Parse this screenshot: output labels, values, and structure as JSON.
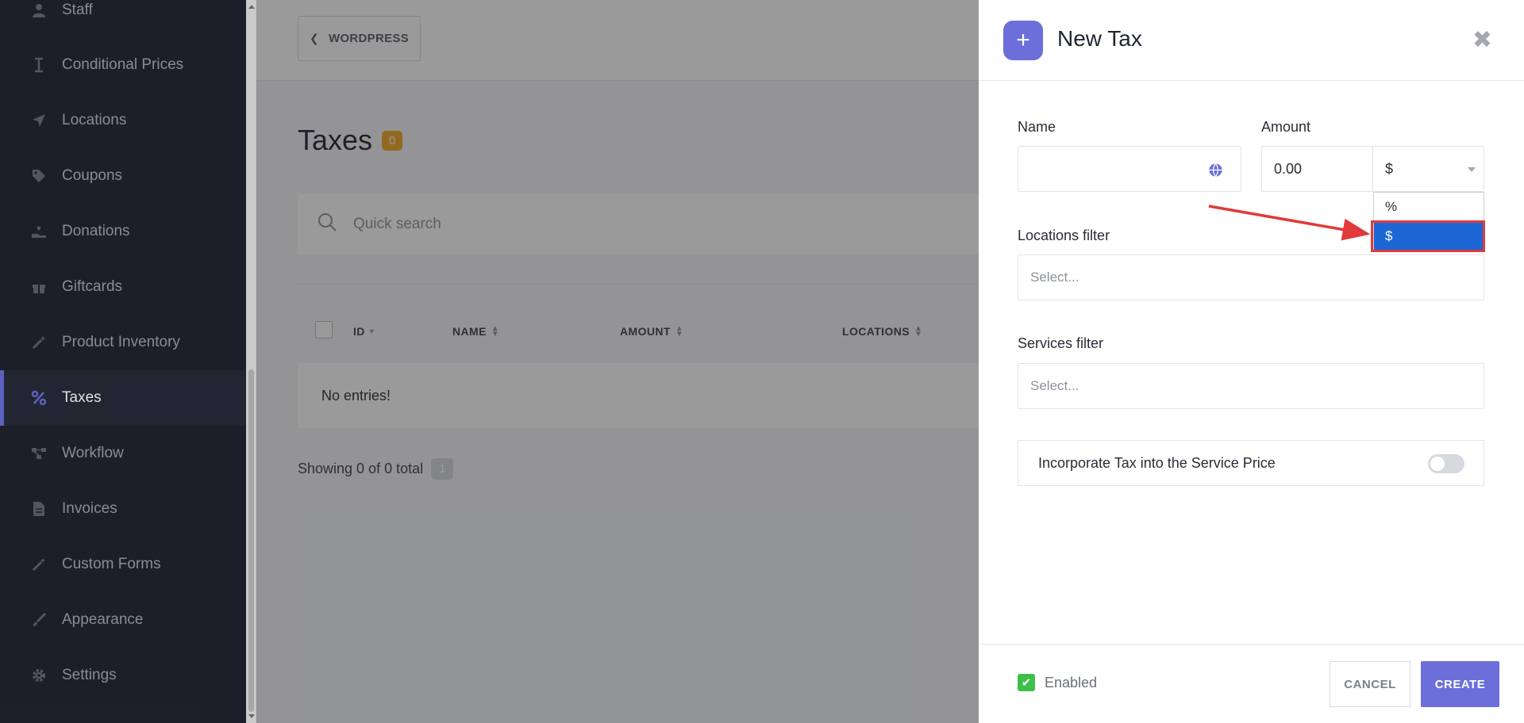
{
  "sidebar": {
    "items": [
      {
        "label": "Staff",
        "icon": "user-icon"
      },
      {
        "label": "Conditional Prices",
        "icon": "cursor-icon"
      },
      {
        "label": "Locations",
        "icon": "location-arrow-icon"
      },
      {
        "label": "Coupons",
        "icon": "tag-icon"
      },
      {
        "label": "Donations",
        "icon": "hand-heart-icon"
      },
      {
        "label": "Giftcards",
        "icon": "gift-icon"
      },
      {
        "label": "Product Inventory",
        "icon": "wand-icon"
      },
      {
        "label": "Taxes",
        "icon": "percent-icon"
      },
      {
        "label": "Workflow",
        "icon": "workflow-icon"
      },
      {
        "label": "Invoices",
        "icon": "document-icon"
      },
      {
        "label": "Custom Forms",
        "icon": "wand-icon"
      },
      {
        "label": "Appearance",
        "icon": "brush-icon"
      },
      {
        "label": "Settings",
        "icon": "gear-icon"
      }
    ]
  },
  "topbar": {
    "back_label": "WORDPRESS"
  },
  "page": {
    "title": "Taxes",
    "count": "0",
    "search_placeholder": "Quick search",
    "columns": {
      "id": "ID",
      "name": "NAME",
      "amount": "AMOUNT",
      "locations": "LOCATIONS"
    },
    "empty_text": "No entries!",
    "showing_text": "Showing 0 of 0 total",
    "page_number": "1"
  },
  "panel": {
    "title": "New Tax",
    "name_label": "Name",
    "name_value": "",
    "amount_label": "Amount",
    "amount_value": "0.00",
    "amount_type_selected": "$",
    "amount_type_options": [
      "%",
      "$"
    ],
    "locations_label": "Locations filter",
    "locations_placeholder": "Select...",
    "services_label": "Services filter",
    "services_placeholder": "Select...",
    "incorporate_label": "Incorporate Tax into the Service Price",
    "incorporate_on": false,
    "enabled_label": "Enabled",
    "enabled_checked": true,
    "cancel_label": "CANCEL",
    "create_label": "CREATE"
  },
  "colors": {
    "accent": "#6c6fd9",
    "badge": "#f2a623",
    "dropdown_selected": "#1d66d6",
    "annotation": "#e03a3a",
    "checkbox": "#3fbf4a"
  }
}
